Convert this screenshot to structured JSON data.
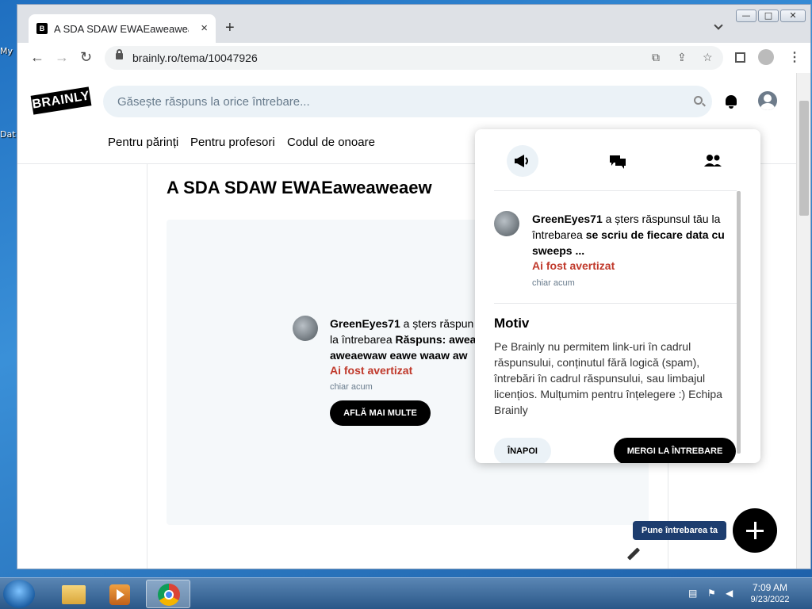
{
  "desktop": {
    "icon_label_1": "My",
    "icon_label_2": "Dat"
  },
  "browser": {
    "tab_title": "A SDA SDAW EWAEaweaweaew",
    "tab_favicon": "B",
    "tab_close": "×",
    "new_tab": "+",
    "url": "brainly.ro/tema/10047926",
    "win_min": "—",
    "win_max": "□",
    "win_close": "✕"
  },
  "site": {
    "logo_text": "BRAINLY",
    "search_placeholder": "Găsește răspuns la orice întrebare...",
    "nav": [
      "Pentru părinți",
      "Pentru profesori",
      "Codul de onoare"
    ],
    "question_title": "A SDA SDAW EWAEaweaweaew"
  },
  "notification_inline": {
    "user": "GreenEyes71",
    "text_1": " a șters răspun",
    "text_2": "la întrebarea ",
    "bold_1": "Răspuns: awea",
    "bold_2": "aweaewaw eawe waaw aw",
    "warning": "Ai fost avertizat",
    "time": "chiar acum",
    "button": "AFLĂ MAI MULTE"
  },
  "popup": {
    "user": "GreenEyes71",
    "text_1": " a șters răspunsul tău la întrebarea ",
    "bold": "se scriu de fiecare data cu sweeps ...",
    "warning": "Ai fost avertizat",
    "time": "chiar acum",
    "motiv_heading": "Motiv",
    "motiv_text": "Pe Brainly nu permitem link-uri în cadrul răspunsului, conținutul fără logică (spam), întrebări în cadrul răspunsului, sau limbajul licențios. Mulțumim pentru înțelegere :) Echipa Brainly",
    "back_button": "ÎNAPOI",
    "go_button": "MERGI LA ÎNTREBARE"
  },
  "fab_label": "Pune întrebarea ta",
  "taskbar": {
    "time": "7:09 AM",
    "date": "9/23/2022"
  },
  "icons": [
    "search-icon",
    "bell-icon",
    "avatar-icon",
    "megaphone-icon",
    "chat-icon",
    "people-icon",
    "plus-icon",
    "pencil-icon",
    "translate-icon",
    "share-icon",
    "star-icon",
    "sidepanel-icon",
    "menu-icon"
  ]
}
